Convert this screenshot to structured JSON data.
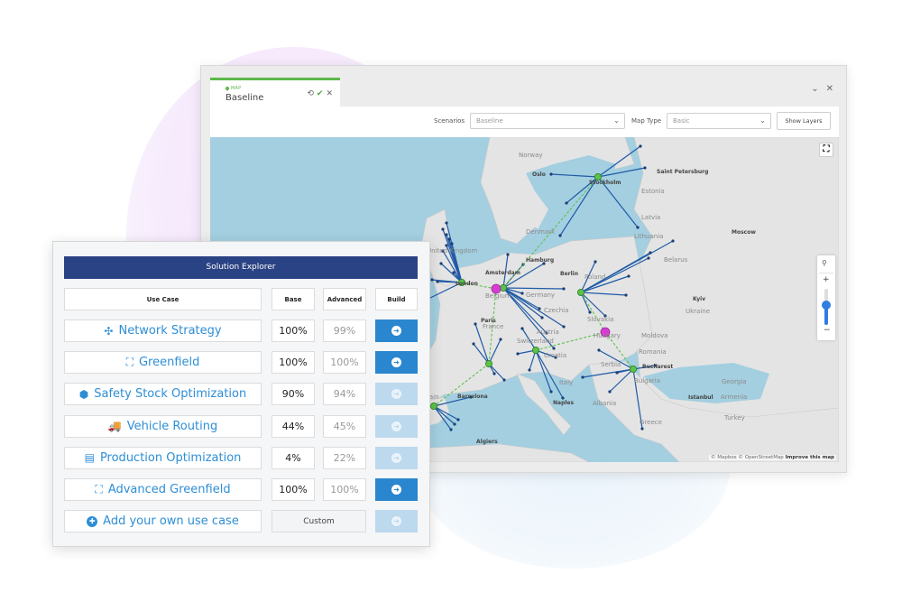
{
  "map_window": {
    "tab": {
      "kicker": "MAP",
      "title": "Baseline",
      "icons": [
        "refresh-icon",
        "check-icon",
        "close-icon"
      ]
    },
    "window_controls": {
      "collapse": "⌄",
      "close": "✕"
    },
    "toolbar": {
      "scenarios_label": "Scenarios",
      "scenarios_value": "Baseline",
      "map_type_label": "Map Type",
      "map_type_value": "Basic",
      "show_layers_label": "Show Layers"
    },
    "map": {
      "zoom_level_fraction": 0.55,
      "attribution": "© Mapbox © OpenStreetMap",
      "attribution_link": "Improve this map",
      "colors": {
        "water": "#a3cfe0",
        "land": "#e4e4e4",
        "route": "#1f5aa6",
        "link": "#5cc24a",
        "hub": "#5cc24a",
        "hub_special": "#d63ed0"
      },
      "labels": [
        {
          "text": "Norway",
          "bold": false
        },
        {
          "text": "Oslo",
          "bold": true
        },
        {
          "text": "Stockholm",
          "bold": true
        },
        {
          "text": "Saint Petersburg",
          "bold": true
        },
        {
          "text": "Estonia",
          "bold": false
        },
        {
          "text": "Latvia",
          "bold": false
        },
        {
          "text": "Lithuania",
          "bold": false
        },
        {
          "text": "Denmark",
          "bold": false
        },
        {
          "text": "Moscow",
          "bold": true
        },
        {
          "text": "United Kingdom",
          "bold": false
        },
        {
          "text": "Hamburg",
          "bold": true
        },
        {
          "text": "Amsterdam",
          "bold": true
        },
        {
          "text": "Berlin",
          "bold": true
        },
        {
          "text": "Belarus",
          "bold": false
        },
        {
          "text": "Poland",
          "bold": false
        },
        {
          "text": "London",
          "bold": true
        },
        {
          "text": "Belgium",
          "bold": false
        },
        {
          "text": "Germany",
          "bold": false
        },
        {
          "text": "Kyiv",
          "bold": true
        },
        {
          "text": "Ukraine",
          "bold": false
        },
        {
          "text": "Czechia",
          "bold": false
        },
        {
          "text": "Paris",
          "bold": true
        },
        {
          "text": "Slovakia",
          "bold": false
        },
        {
          "text": "France",
          "bold": false
        },
        {
          "text": "Austria",
          "bold": false
        },
        {
          "text": "Hungary",
          "bold": false
        },
        {
          "text": "Moldova",
          "bold": false
        },
        {
          "text": "Switzerland",
          "bold": false
        },
        {
          "text": "Romania",
          "bold": false
        },
        {
          "text": "Croatia",
          "bold": false
        },
        {
          "text": "Bucharest",
          "bold": true
        },
        {
          "text": "Serbia",
          "bold": false
        },
        {
          "text": "Bulgaria",
          "bold": false
        },
        {
          "text": "Italy",
          "bold": false
        },
        {
          "text": "Barcelona",
          "bold": true
        },
        {
          "text": "Naples",
          "bold": true
        },
        {
          "text": "Albania",
          "bold": false
        },
        {
          "text": "Istanbul",
          "bold": true
        },
        {
          "text": "Georgia",
          "bold": false
        },
        {
          "text": "Armenia",
          "bold": false
        },
        {
          "text": "Turkey",
          "bold": false
        },
        {
          "text": "Greece",
          "bold": false
        },
        {
          "text": "Algiers",
          "bold": true
        },
        {
          "text": "Spain",
          "bold": false
        }
      ]
    }
  },
  "explorer": {
    "title": "Solution Explorer",
    "headers": {
      "use_case": "Use Case",
      "base": "Base",
      "advanced": "Advanced",
      "build": "Build"
    },
    "rows": [
      {
        "icon": "network-icon",
        "glyph": "✣",
        "label": "Network Strategy",
        "base": "100%",
        "advanced": "99%",
        "build_enabled": true
      },
      {
        "icon": "greenfield-icon",
        "glyph": "⛶",
        "label": "Greenfield",
        "base": "100%",
        "advanced": "100%",
        "build_enabled": true
      },
      {
        "icon": "cube-icon",
        "glyph": "⬢",
        "label": "Safety Stock Optimization",
        "base": "90%",
        "advanced": "94%",
        "build_enabled": false
      },
      {
        "icon": "truck-icon",
        "glyph": "🚚",
        "label": "Vehicle Routing",
        "base": "44%",
        "advanced": "45%",
        "build_enabled": false
      },
      {
        "icon": "factory-icon",
        "glyph": "▤",
        "label": "Production Optimization",
        "base": "4%",
        "advanced": "22%",
        "build_enabled": false
      },
      {
        "icon": "advanced-greenfield-icon",
        "glyph": "⛶",
        "label": "Advanced Greenfield",
        "base": "100%",
        "advanced": "100%",
        "build_enabled": true
      }
    ],
    "custom_row": {
      "icon": "plus-circle-icon",
      "glyph": "✚",
      "label": "Add your own use case",
      "value": "Custom",
      "build_enabled": false
    },
    "build_glyph": "➜",
    "colors": {
      "header_bg": "#2a4384",
      "link": "#2d8ed6",
      "build_active": "#2a86cf",
      "build_inactive": "#bcd9ee"
    }
  }
}
